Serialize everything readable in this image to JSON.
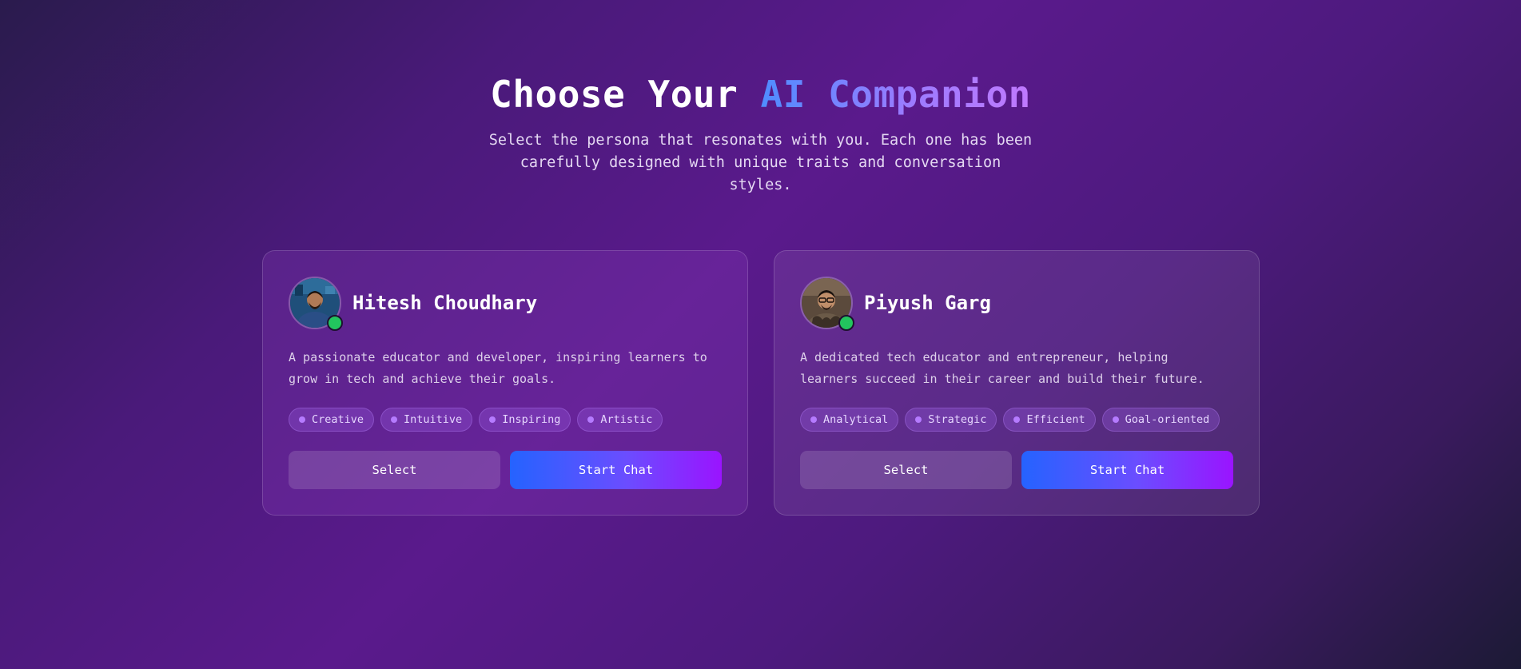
{
  "header": {
    "title_prefix": "Choose Your",
    "title_accent": "AI Companion",
    "subtitle": "Select the persona that resonates with you. Each one has been carefully designed with unique traits and conversation styles."
  },
  "personas": [
    {
      "name": "Hitesh Choudhary",
      "description": "A passionate educator and developer, inspiring learners to grow in tech and achieve their goals.",
      "tags": [
        "Creative",
        "Intuitive",
        "Inspiring",
        "Artistic"
      ],
      "select_label": "Select",
      "chat_label": "Start Chat"
    },
    {
      "name": "Piyush Garg",
      "description": "A dedicated tech educator and entrepreneur, helping learners succeed in their career and build their future.",
      "tags": [
        "Analytical",
        "Strategic",
        "Efficient",
        "Goal-oriented"
      ],
      "select_label": "Select",
      "chat_label": "Start Chat"
    }
  ],
  "colors": {
    "online": "#22c55e",
    "accent_start": "#2563ff",
    "accent_end": "#9a14ff"
  }
}
